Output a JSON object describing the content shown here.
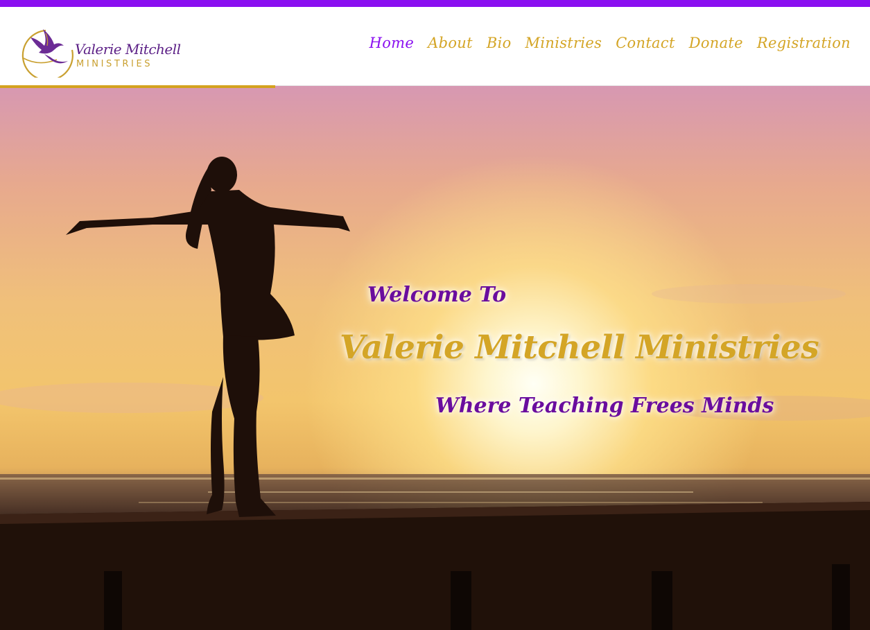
{
  "colors": {
    "brand_purple": "#8a0ff0",
    "brand_gold": "#d4a526",
    "deep_purple": "#6a0d9e"
  },
  "logo": {
    "name": "Valerie Mitchell",
    "subtitle": "MINISTRIES",
    "icon": "dove-icon"
  },
  "nav": {
    "items": [
      {
        "label": "Home",
        "active": true
      },
      {
        "label": "About",
        "active": false
      },
      {
        "label": "Bio",
        "active": false
      },
      {
        "label": "Ministries",
        "active": false
      },
      {
        "label": "Contact",
        "active": false
      },
      {
        "label": "Donate",
        "active": false
      },
      {
        "label": "Registration",
        "active": false
      }
    ]
  },
  "hero": {
    "welcome": "Welcome To",
    "title": "Valerie Mitchell Ministries",
    "tagline": "Where Teaching Frees Minds",
    "image": "woman-silhouette-sunset-pier"
  }
}
